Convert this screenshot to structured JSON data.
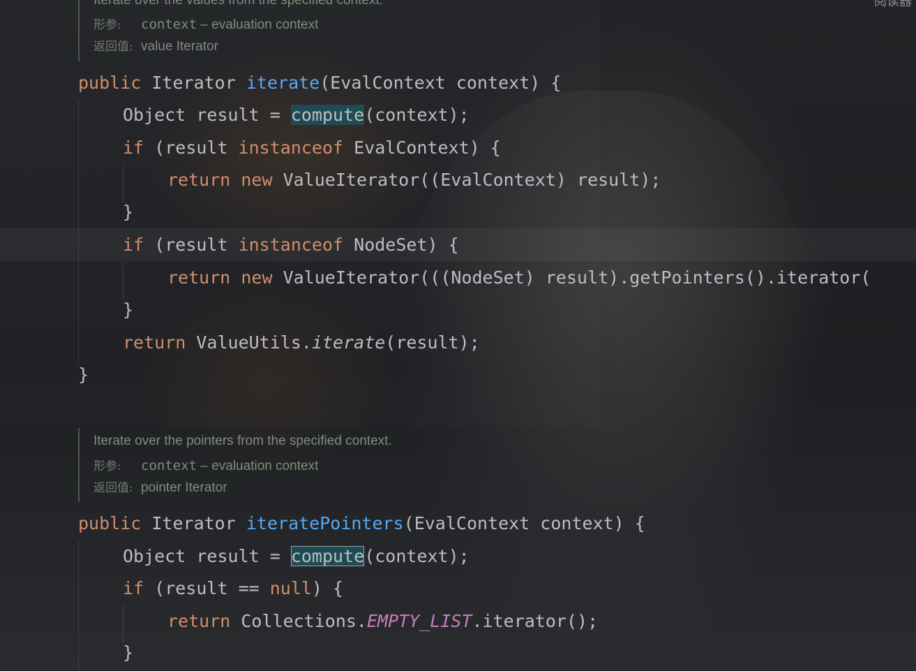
{
  "top_right_text": "阅读器",
  "doc1": {
    "summary": "Iterate over the values from the specified context.",
    "param_label": "形参:",
    "param_name": "context",
    "param_desc": " – evaluation context",
    "return_label": "返回值:",
    "return_desc": "value Iterator"
  },
  "method1": {
    "modifier": "public",
    "return_type": "Iterator",
    "name": "iterate",
    "params": "(EvalContext context) {",
    "line2_prefix": "Object result = ",
    "line2_call": "compute",
    "line2_suffix": "(context);",
    "line3_if": "if",
    "line3_a": " (result ",
    "line3_instanceof": "instanceof",
    "line3_b": " EvalContext) {",
    "line4_return": "return",
    "line4_new": "new",
    "line4_rest": " ValueIterator((EvalContext) result);",
    "line5": "}",
    "line6_if": "if",
    "line6_a": " (result ",
    "line6_instanceof": "instanceof",
    "line6_b": " NodeSet) {",
    "line7_return": "return",
    "line7_new": "new",
    "line7_rest": " ValueIterator(((NodeSet) result).getPointers().iterator(",
    "line8": "}",
    "line9_return": "return",
    "line9_a": " ValueUtils.",
    "line9_call": "iterate",
    "line9_b": "(result);",
    "line10": "}"
  },
  "doc2": {
    "summary": "Iterate over the pointers from the specified context.",
    "param_label": "形参:",
    "param_name": "context",
    "param_desc": " – evaluation context",
    "return_label": "返回值:",
    "return_desc": "pointer Iterator"
  },
  "method2": {
    "modifier": "public",
    "return_type": "Iterator",
    "name": "iteratePointers",
    "params": "(EvalContext context) {",
    "line2_prefix": "Object result = ",
    "line2_call": "compute",
    "line2_suffix": "(context);",
    "line3_if": "if",
    "line3_a": " (result == ",
    "line3_null": "null",
    "line3_b": ") {",
    "line4_return": "return",
    "line4_a": " Collections.",
    "line4_const": "EMPTY_LIST",
    "line4_b": ".iterator();",
    "line5": "}"
  },
  "colors": {
    "keyword": "#cf8e6d",
    "method_decl": "#56a8f5",
    "static_field": "#c77dbb",
    "text": "#bcbec4",
    "doc": "#7c8f7c",
    "usage_highlight": "#1f4b55"
  }
}
